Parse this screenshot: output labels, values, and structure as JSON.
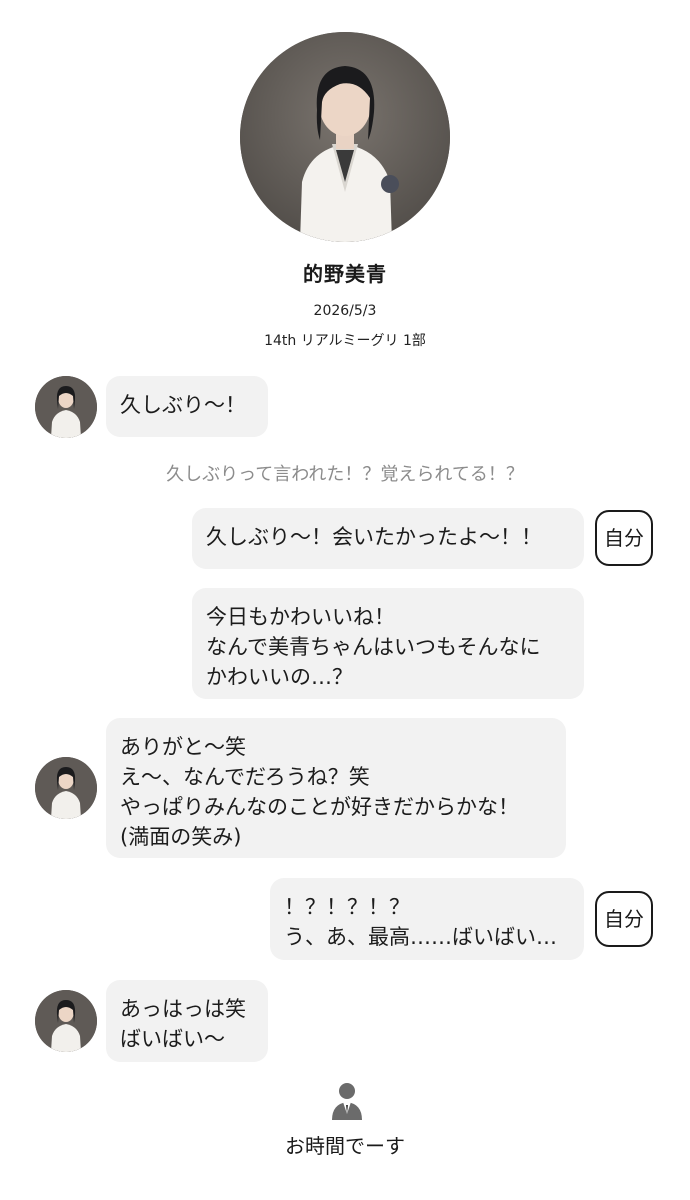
{
  "profile": {
    "name": "的野美青",
    "date": "2026/5/3",
    "event": "14th リアルミーグリ 1部"
  },
  "messages": {
    "m1": {
      "lines": [
        "久しぶり〜！"
      ]
    },
    "aside": "久しぶりって言われた！？覚えられてる！？",
    "m2": {
      "lines": [
        "久しぶり〜！会いたかったよ〜！！"
      ],
      "tag": "自分"
    },
    "m3": {
      "lines": [
        "今日もかわいいね！",
        "なんで美青ちゃんはいつもそんなに",
        "かわいいの…？"
      ]
    },
    "m4": {
      "lines": [
        "ありがと〜笑",
        "え〜、なんでだろうね？笑",
        "やっぱりみんなのことが好きだからかな！",
        "(満面の笑み)"
      ]
    },
    "m5": {
      "lines": [
        "！？！？！？",
        "う、あ、最高……ばいばい…"
      ],
      "tag": "自分"
    },
    "m6": {
      "lines": [
        "あっはっは笑",
        "ばいばい〜"
      ]
    }
  },
  "footer": {
    "end_label": "お時間でーす",
    "icon": "person-icon"
  },
  "colors": {
    "bubble": "#f2f2f2",
    "aside_text": "#8c8c8c",
    "tag_border": "#1a1a1a"
  }
}
